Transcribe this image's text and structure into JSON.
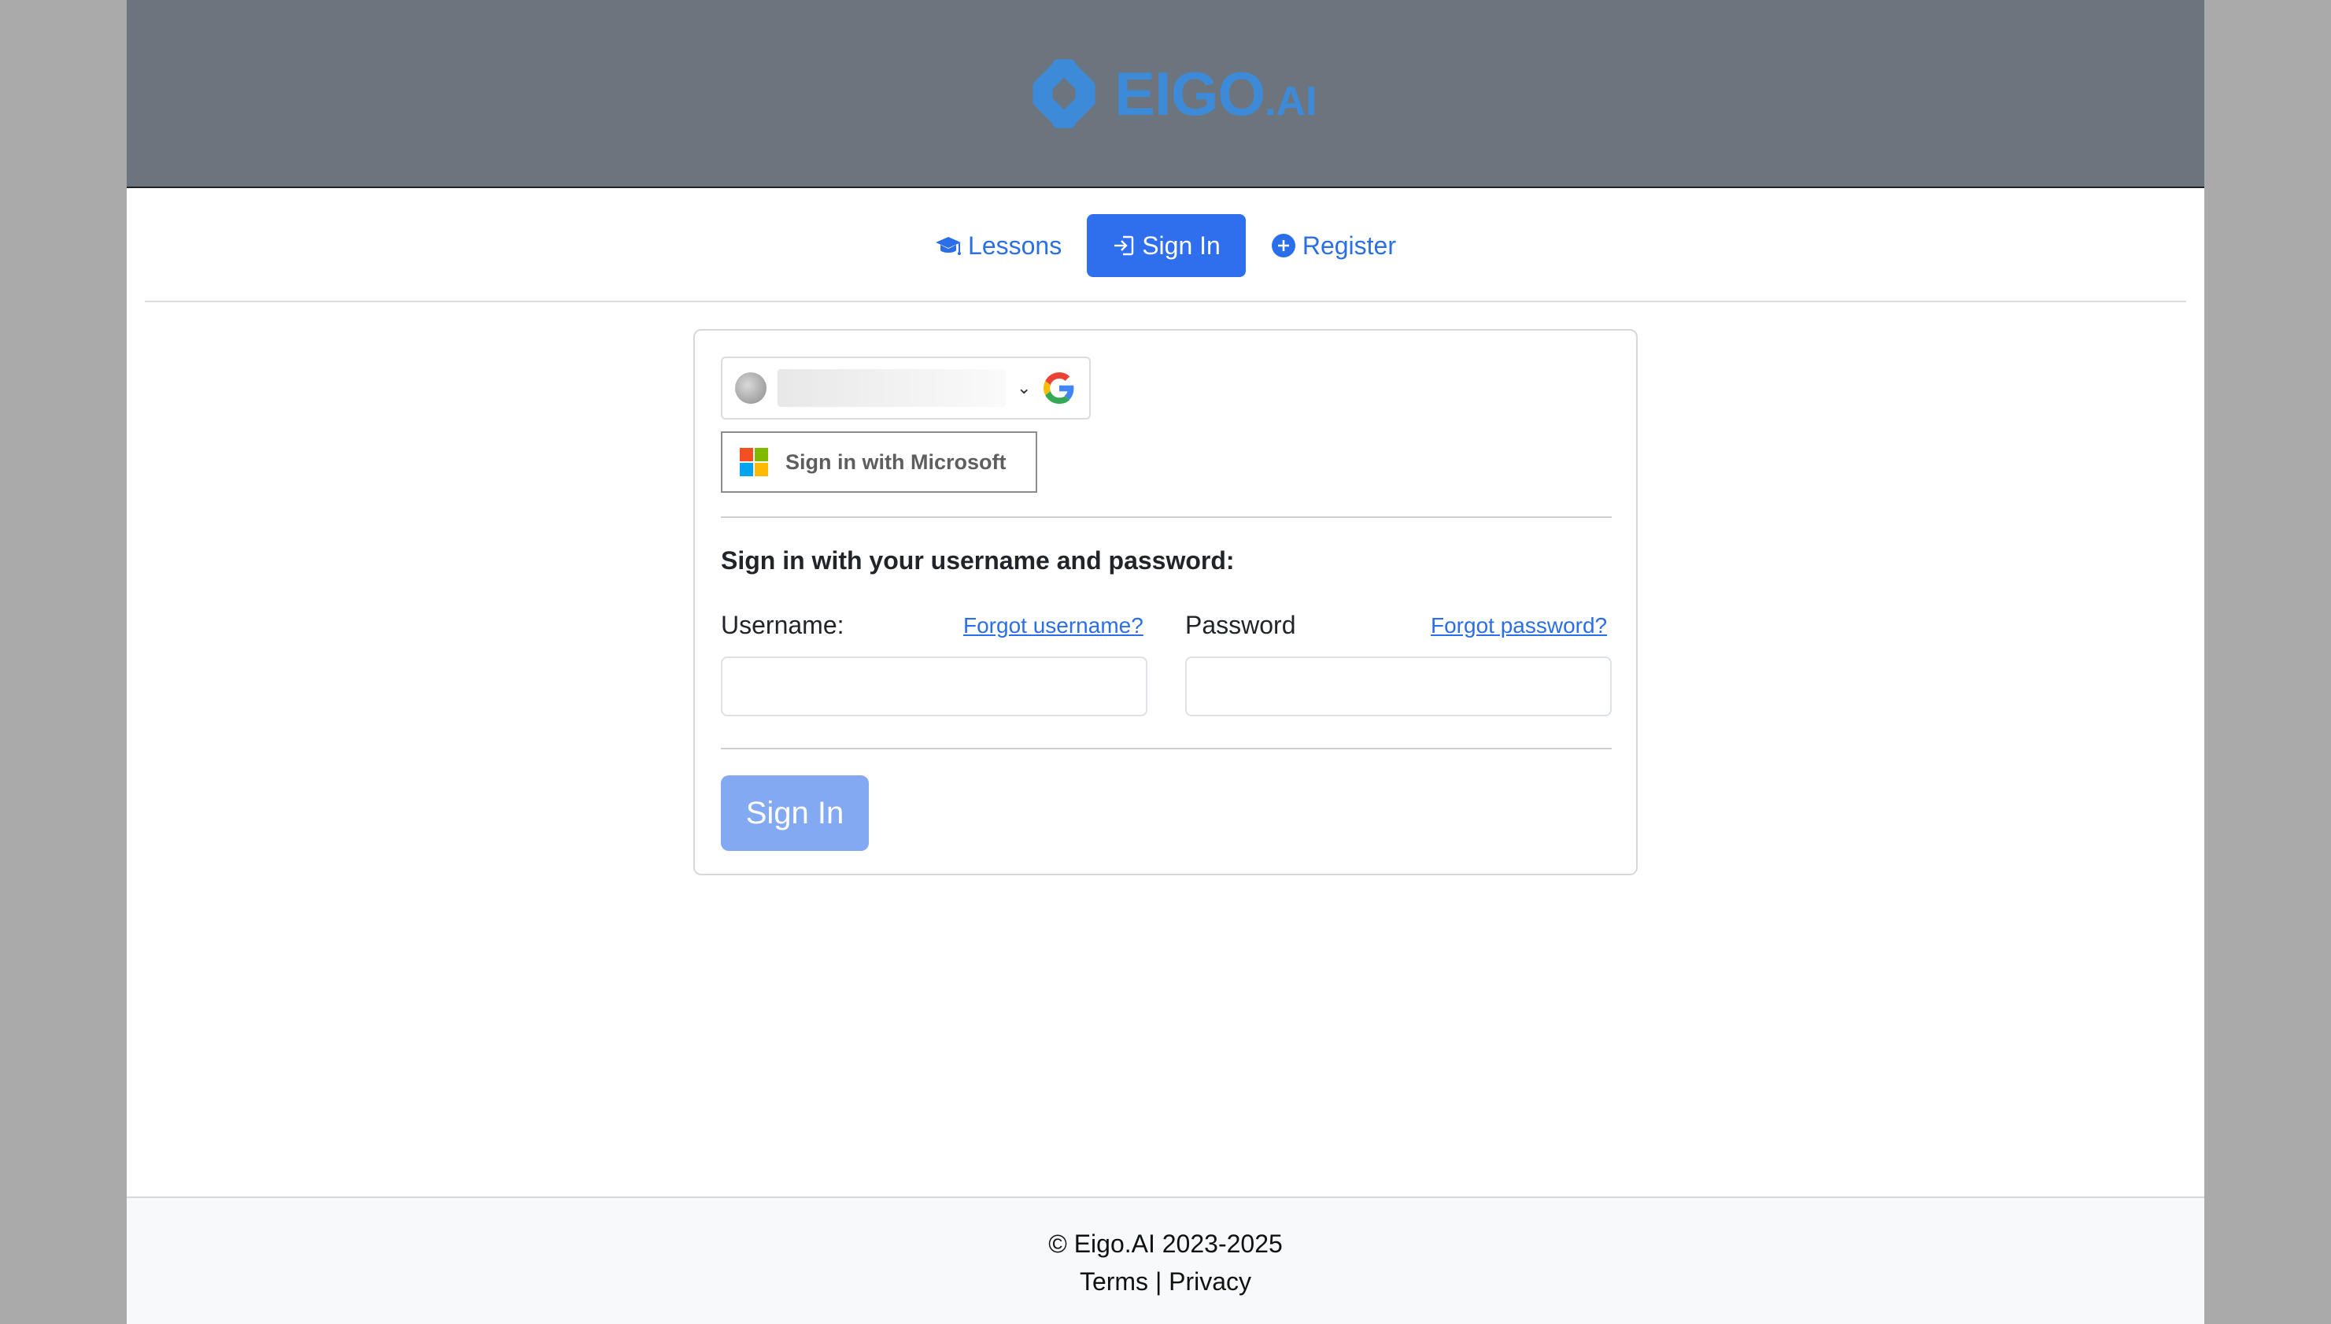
{
  "header": {
    "brand_main": "EIGO",
    "brand_suffix": ".AI"
  },
  "nav": {
    "lessons": "Lessons",
    "signin": "Sign In",
    "register": "Register"
  },
  "oauth": {
    "microsoft_label": "Sign in with Microsoft"
  },
  "form": {
    "heading": "Sign in with your username and password:",
    "username_label": "Username:",
    "forgot_username": "Forgot username?",
    "password_label": "Password",
    "forgot_password": "Forgot password?",
    "username_value": "",
    "password_value": "",
    "submit_label": "Sign In"
  },
  "footer": {
    "copyright": "© Eigo.AI 2023-2025",
    "terms": "Terms",
    "separator": " | ",
    "privacy": "Privacy"
  },
  "colors": {
    "header_bg": "#6c757d",
    "brand": "#3d8bd8",
    "link": "#2a6fe8",
    "primary": "#2f6fed",
    "primary_disabled": "#83a9f3"
  }
}
